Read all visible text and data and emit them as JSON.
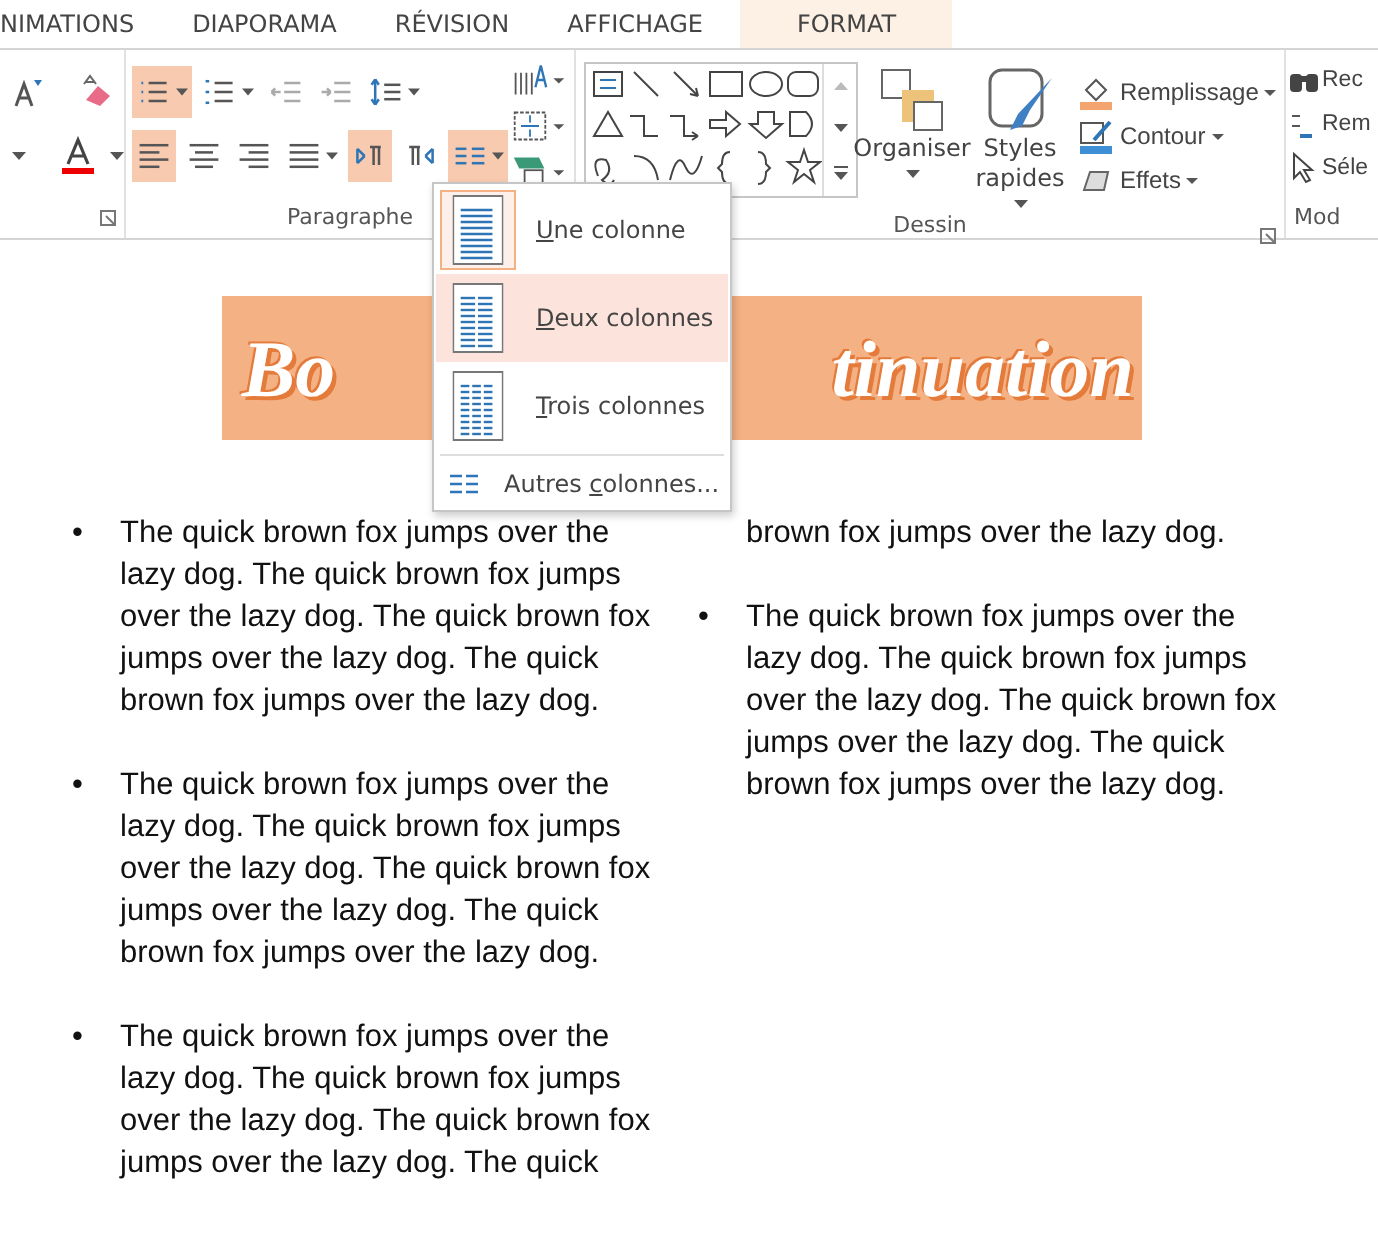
{
  "tabs": [
    {
      "label": "NIMATIONS",
      "selected": false,
      "contextual": false
    },
    {
      "label": "DIAPORAMA",
      "selected": false,
      "contextual": false
    },
    {
      "label": "RÉVISION",
      "selected": false,
      "contextual": false
    },
    {
      "label": "AFFICHAGE",
      "selected": false,
      "contextual": false
    },
    {
      "label": "FORMAT",
      "selected": false,
      "contextual": true
    }
  ],
  "paragraph_group": {
    "label": "Paragraphe",
    "row_1": [
      {
        "kind": "bullets",
        "on": true,
        "dropdown": true
      },
      {
        "kind": "numbering",
        "on": false,
        "dropdown": true
      },
      {
        "kind": "outdent",
        "on": false,
        "dropdown": false
      },
      {
        "kind": "indent",
        "on": false,
        "dropdown": false
      },
      {
        "kind": "spacing",
        "on": false,
        "dropdown": true
      }
    ],
    "row_2": [
      {
        "kind": "left",
        "on": true,
        "dropdown": false
      },
      {
        "kind": "center",
        "on": false,
        "dropdown": false
      },
      {
        "kind": "right",
        "on": false,
        "dropdown": false
      },
      {
        "kind": "justify",
        "on": false,
        "dropdown": true
      },
      {
        "kind": "ltr",
        "on": true,
        "dropdown": false
      },
      {
        "kind": "rtl",
        "on": false,
        "dropdown": false
      },
      {
        "kind": "columns",
        "on": true,
        "dropdown": true
      }
    ]
  },
  "drawing_group": {
    "label": "Dessin",
    "large_buttons": [
      {
        "kind": "arrange",
        "lines": [
          "Organiser"
        ]
      },
      {
        "kind": "styles",
        "lines": [
          "Styles",
          "rapides"
        ]
      }
    ],
    "small_buttons": [
      {
        "kind": "fill",
        "label": "Remplissage"
      },
      {
        "kind": "outline",
        "label": "Contour"
      },
      {
        "kind": "effects",
        "label": "Effets"
      }
    ]
  },
  "editing_group": {
    "label": "Mod",
    "buttons": [
      {
        "kind": "find",
        "label": "Rec"
      },
      {
        "kind": "replace",
        "label": "Rem"
      },
      {
        "kind": "select",
        "label": "Séle"
      }
    ]
  },
  "columns_menu": {
    "items": [
      {
        "kind": "one",
        "key": "U",
        "post": "ne colonne",
        "selected": true,
        "highlighted": false
      },
      {
        "kind": "two",
        "key": "D",
        "post": "eux colonnes",
        "selected": false,
        "highlighted": true
      },
      {
        "kind": "three",
        "key": "T",
        "post": "rois colonnes",
        "selected": false,
        "highlighted": false
      }
    ],
    "more": {
      "pre": "Autres ",
      "key": "c",
      "post": "olonnes..."
    }
  },
  "banner": {
    "left_text": "Bo",
    "right_text": "tinuation"
  },
  "text_columns": [
    [
      {
        "bullet": "•",
        "lines": [
          "The quick brown fox jumps over the",
          "lazy dog. The quick brown fox jumps",
          "over the lazy dog. The quick brown fox",
          "jumps over the lazy dog. The quick",
          "brown fox jumps over the lazy dog."
        ]
      },
      {
        "bullet": "•",
        "lines": [
          "The quick brown fox jumps over the",
          "lazy dog. The quick brown fox jumps",
          "over the lazy dog. The quick brown fox",
          "jumps over the lazy dog. The quick",
          "brown fox jumps over the lazy dog."
        ]
      },
      {
        "bullet": "•",
        "lines": [
          "The quick brown fox jumps over the",
          "lazy dog. The quick brown fox jumps",
          "over the lazy dog. The quick brown fox",
          "jumps over the lazy dog. The quick"
        ]
      }
    ],
    [
      {
        "lines": [
          "brown fox jumps over the lazy dog."
        ]
      },
      {
        "bullet": "•",
        "lines": [
          "The quick brown fox jumps over the",
          "lazy dog. The quick brown fox jumps",
          "over the lazy dog. The quick brown fox",
          "jumps over the lazy dog. The quick",
          "brown fox jumps over the lazy dog."
        ]
      }
    ]
  ]
}
